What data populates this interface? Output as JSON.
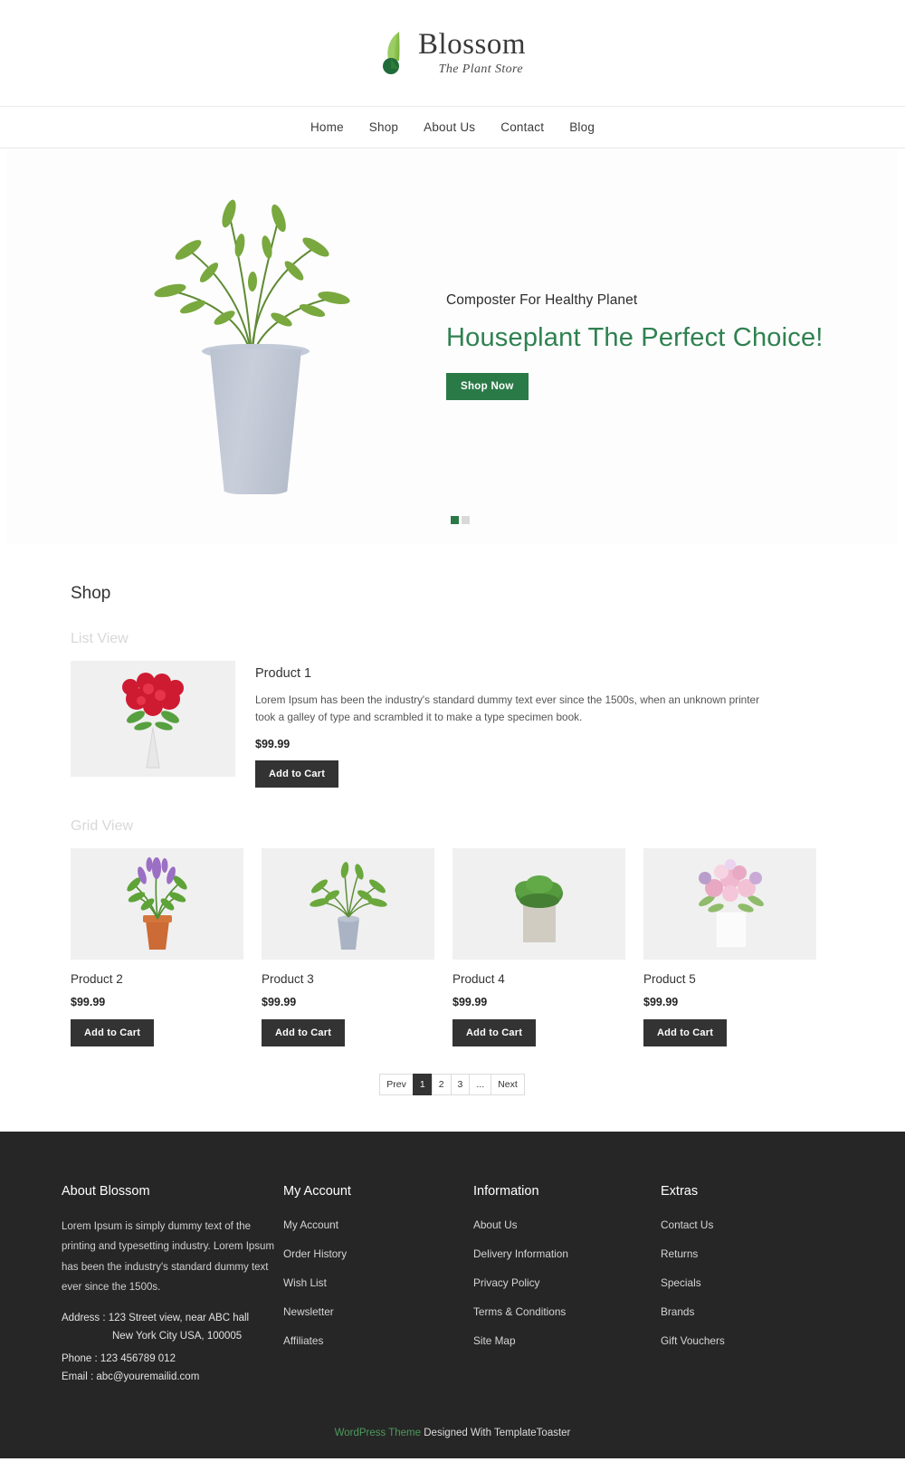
{
  "header": {
    "logo_name": "Blossom",
    "logo_tagline": "The Plant Store",
    "logo_icon": "leaf-icon"
  },
  "nav": {
    "items": [
      {
        "label": "Home"
      },
      {
        "label": "Shop"
      },
      {
        "label": "About Us"
      },
      {
        "label": "Contact"
      },
      {
        "label": "Blog"
      }
    ]
  },
  "hero": {
    "subtitle": "Composter For Healthy Planet",
    "title": "Houseplant The Perfect Choice!",
    "button_label": "Shop Now",
    "accent_color": "#2f8150",
    "button_color": "#2a7a47",
    "slides": 2,
    "active_slide": 1
  },
  "shop": {
    "title": "Shop",
    "list_view_label": "List View",
    "grid_view_label": "Grid View",
    "list_product": {
      "name": "Product 1",
      "description": "Lorem Ipsum has been the industry's standard dummy text ever since the 1500s, when an unknown printer took a galley of type and scrambled it to make a type specimen book.",
      "price": "$99.99",
      "cart_label": "Add to Cart"
    },
    "grid_products": [
      {
        "name": "Product 2",
        "price": "$99.99",
        "cart_label": "Add to Cart"
      },
      {
        "name": "Product 3",
        "price": "$99.99",
        "cart_label": "Add to Cart"
      },
      {
        "name": "Product 4",
        "price": "$99.99",
        "cart_label": "Add to Cart"
      },
      {
        "name": "Product 5",
        "price": "$99.99",
        "cart_label": "Add to Cart"
      }
    ],
    "pagination": [
      {
        "label": "Prev",
        "active": false
      },
      {
        "label": "1",
        "active": true
      },
      {
        "label": "2",
        "active": false
      },
      {
        "label": "3",
        "active": false
      },
      {
        "label": "...",
        "active": false
      },
      {
        "label": "Next",
        "active": false
      }
    ]
  },
  "footer": {
    "about": {
      "heading": "About Blossom",
      "text": "Lorem Ipsum is simply dummy text of the printing and typesetting industry. Lorem Ipsum has been the industry's standard dummy text ever since the 1500s.",
      "address_label": "Address : 123 Street view, near ABC hall",
      "address_line2": "New York City USA, 100005",
      "phone": "Phone : 123 456789 012",
      "email": "Email : abc@youremailid.com"
    },
    "my_account": {
      "heading": "My Account",
      "items": [
        {
          "label": "My Account"
        },
        {
          "label": "Order History"
        },
        {
          "label": "Wish List"
        },
        {
          "label": "Newsletter"
        },
        {
          "label": "Affiliates"
        }
      ]
    },
    "information": {
      "heading": "Information",
      "items": [
        {
          "label": "About Us"
        },
        {
          "label": "Delivery Information"
        },
        {
          "label": "Privacy Policy"
        },
        {
          "label": "Terms & Conditions"
        },
        {
          "label": "Site Map"
        }
      ]
    },
    "extras": {
      "heading": "Extras",
      "items": [
        {
          "label": "Contact Us"
        },
        {
          "label": "Returns"
        },
        {
          "label": "Specials"
        },
        {
          "label": "Brands"
        },
        {
          "label": "Gift Vouchers"
        }
      ]
    },
    "bottom": {
      "wp_text": "WordPress Theme",
      "rest_text": " Designed With TemplateToaster"
    }
  }
}
